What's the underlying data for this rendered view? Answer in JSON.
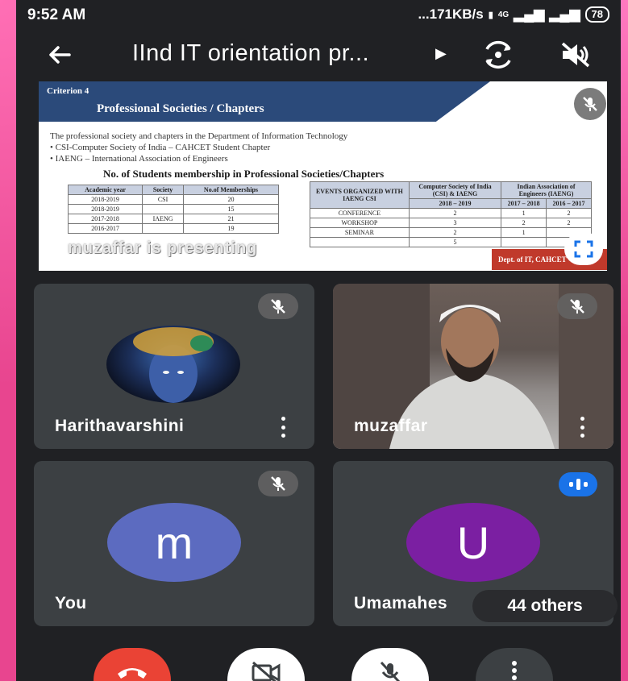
{
  "status_bar": {
    "time": "9:52 AM",
    "network_speed": "...171KB/s",
    "signal": "4G",
    "battery": "78"
  },
  "top_bar": {
    "meeting_title": "IInd IT orientation pr..."
  },
  "presentation": {
    "presenter_text": "muzaffar is presenting",
    "slide": {
      "criterion": "Criterion 4",
      "heading": "Professional Societies / Chapters",
      "intro": "The professional society and chapters in the Department of Information Technology",
      "bullet1": "• CSI-Computer Society of India – CAHCET Student Chapter",
      "bullet2": "• IAENG – International Association of Engineers",
      "subtitle": "No. of Students membership in Professional Societies/Chapters",
      "footer": "Dept. of IT, CAHCET",
      "membership_table": {
        "headers": [
          "Academic year",
          "Society",
          "No.of Memberships"
        ],
        "rows": [
          [
            "2018-2019",
            "CSI",
            "20"
          ],
          [
            "2018-2019",
            "",
            "15"
          ],
          [
            "2017-2018",
            "IAENG",
            "21"
          ],
          [
            "2016-2017",
            "",
            "19"
          ]
        ]
      },
      "events_table": {
        "col_header": "EVENTS ORGANIZED WITH IAENG CSI",
        "group1": "Computer Society of India (CSI) & IAENG",
        "group2": "Indian Association of Engineers (IAENG)",
        "years": [
          "2018 – 2019",
          "2017 – 2018",
          "2016 – 2017"
        ],
        "rows": [
          [
            "CONFERENCE",
            "2",
            "1",
            "2"
          ],
          [
            "WORKSHOP",
            "3",
            "2",
            "2"
          ],
          [
            "SEMINAR",
            "2",
            "1",
            ""
          ],
          [
            "",
            "5",
            "",
            ""
          ]
        ]
      }
    }
  },
  "participants": [
    {
      "name": "Harithavarshini",
      "initial": "",
      "muted": true
    },
    {
      "name": "muzaffar",
      "initial": "",
      "muted": true
    },
    {
      "name": "You",
      "initial": "m",
      "muted": true,
      "avatar_color": "#5c6bc0"
    },
    {
      "name": "Umamahes",
      "initial": "U",
      "speaking": true,
      "avatar_color": "#7b1fa2"
    }
  ],
  "others_count_label": "44 others",
  "colors": {
    "end_call": "#ea4335",
    "speaking": "#1a73e8",
    "tile": "#3c4043",
    "background": "#202124"
  }
}
